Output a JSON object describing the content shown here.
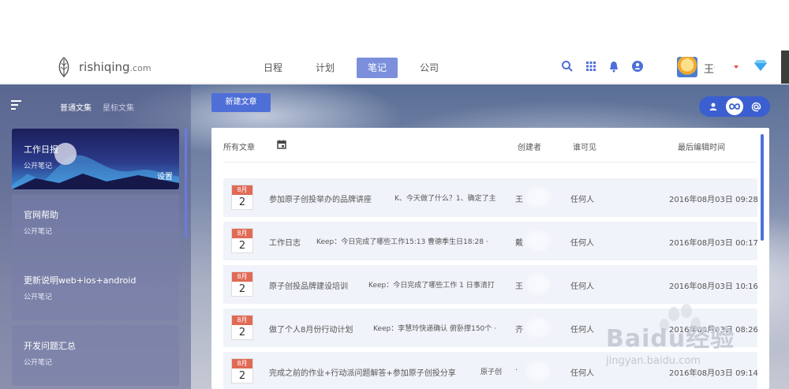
{
  "header": {
    "logo_text": "rishiqing",
    "logo_suffix": ".com",
    "nav": [
      {
        "label": "日程"
      },
      {
        "label": "计划"
      },
      {
        "label": "笔记",
        "active": true
      },
      {
        "label": "公司"
      }
    ],
    "username": "王f",
    "icons": [
      "search-icon",
      "apps-grid-icon",
      "bell-icon",
      "user-badge-icon",
      "diamond-icon"
    ]
  },
  "sidebar": {
    "tabs": [
      "普通文集",
      "星标文集"
    ],
    "collections": [
      {
        "title": "工作日报",
        "subtitle": "公开笔记",
        "action": "设置",
        "active": true
      },
      {
        "title": "官网帮助",
        "subtitle": "公开笔记"
      },
      {
        "title": "更新说明web+ios+android",
        "subtitle": "公开笔记"
      },
      {
        "title": "开发问题汇总",
        "subtitle": "公开笔记"
      }
    ]
  },
  "main": {
    "new_button": "新建文章",
    "view_switch": [
      "person-icon",
      "infinity-icon",
      "at-icon"
    ],
    "table": {
      "headers": {
        "all": "所有文章",
        "creator": "创建者",
        "visibility": "谁可见",
        "updated": "最后编辑时间"
      },
      "rows": [
        {
          "month": "8月",
          "day": "2",
          "title": "参加原子创投举办的品牌讲座",
          "snippet": "K、今天做了什么？1、确定了主",
          "creator": "王",
          "visibility": "任何人",
          "time": "2016年08月03日 09:28"
        },
        {
          "month": "8月",
          "day": "2",
          "title": "工作日志",
          "snippet": "Keep：今日完成了哪些工作15:13  曹德季生日18:28  ·",
          "creator": "戴",
          "visibility": "任何人",
          "time": "2016年08月03日 00:17"
        },
        {
          "month": "8月",
          "day": "2",
          "title": "原子创投品牌建设培训",
          "snippet": "Keep：今日完成了哪些工作 1  日事清打",
          "creator": "王",
          "visibility": "任何人",
          "time": "2016年08月03日 10:16"
        },
        {
          "month": "8月",
          "day": "2",
          "title": "做了个人8月份行动计划",
          "snippet": "Keep：李慧玲快递确认 俯卧撑150个 ·",
          "creator": "齐",
          "visibility": "任何人",
          "time": "2016年08月03日 08:26"
        },
        {
          "month": "8月",
          "day": "2",
          "title": "完成之前的作业+行动派问题解答+参加原子创投分享",
          "snippet": "原子创",
          "creator": "·",
          "visibility": "任何人",
          "time": "2016年08月03日 09:14"
        }
      ]
    }
  },
  "watermark": {
    "text": "Baidu经验",
    "sub": "jingyan.baidu.com"
  }
}
